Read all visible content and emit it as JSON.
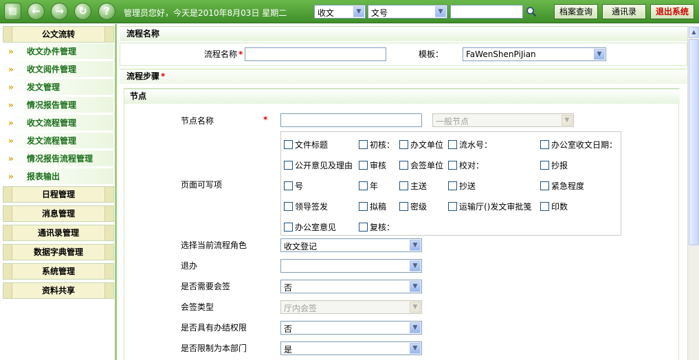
{
  "topbar": {
    "greeting": "管理员您好，今天是2010年8月03日 星期二",
    "doc_type_select": "收文",
    "field_select": "文号",
    "search_value": "",
    "buttons": {
      "archive_query": "档案查询",
      "address_book": "通讯录",
      "exit": "退出系统"
    },
    "nav_icons": [
      "document-icon",
      "back-icon",
      "forward-icon",
      "refresh-icon",
      "help-icon"
    ]
  },
  "sidebar": {
    "section_title": "公文流转",
    "items": [
      {
        "label": "收文办件管理"
      },
      {
        "label": "收文阅件管理"
      },
      {
        "label": "发文管理"
      },
      {
        "label": "情况报告管理"
      },
      {
        "label": "收文流程管理"
      },
      {
        "label": "发文流程管理"
      },
      {
        "label": "情况报告流程管理"
      },
      {
        "label": "报表输出"
      }
    ],
    "groups": [
      {
        "label": "日程管理"
      },
      {
        "label": "消息管理"
      },
      {
        "label": "通讯录管理"
      },
      {
        "label": "数据字典管理"
      },
      {
        "label": "系统管理"
      },
      {
        "label": "资料共享"
      }
    ]
  },
  "main": {
    "flow_name_section": "流程名称",
    "flow_name_label": "流程名称",
    "flow_name_value": "",
    "template_label": "模板：",
    "template_value": "FaWenShenPiJian",
    "steps_section": "流程步骤",
    "node_section": "节点",
    "node_name_label": "节点名称",
    "node_name_value": "",
    "node_type_value": "一般节点",
    "writable_label": "页面可写项",
    "checkboxes": [
      "文件标题",
      "初核：",
      "办文单位",
      "流水号：",
      "办公室收文日期：",
      "公开意见及理由",
      "审核",
      "会签单位",
      "校对：",
      "抄报",
      "号",
      "年",
      "主送",
      "抄送",
      "紧急程度",
      "领导签发",
      "拟稿",
      "密级",
      "运输厅()发文审批笺",
      "印数",
      "办公室意见",
      "复核："
    ],
    "fields": {
      "role_label": "选择当前流程角色",
      "role_value": "收文登记",
      "return_label": "退办",
      "return_value": "",
      "countersign_label": "是否需要会签",
      "countersign_value": "否",
      "countersign_type_label": "会签类型",
      "countersign_type_value": "厅内会签",
      "closing_label": "是否具有办结权限",
      "closing_value": "否",
      "dept_label": "是否限制为本部门",
      "dept_value": "是"
    },
    "required_mark": "*"
  }
}
